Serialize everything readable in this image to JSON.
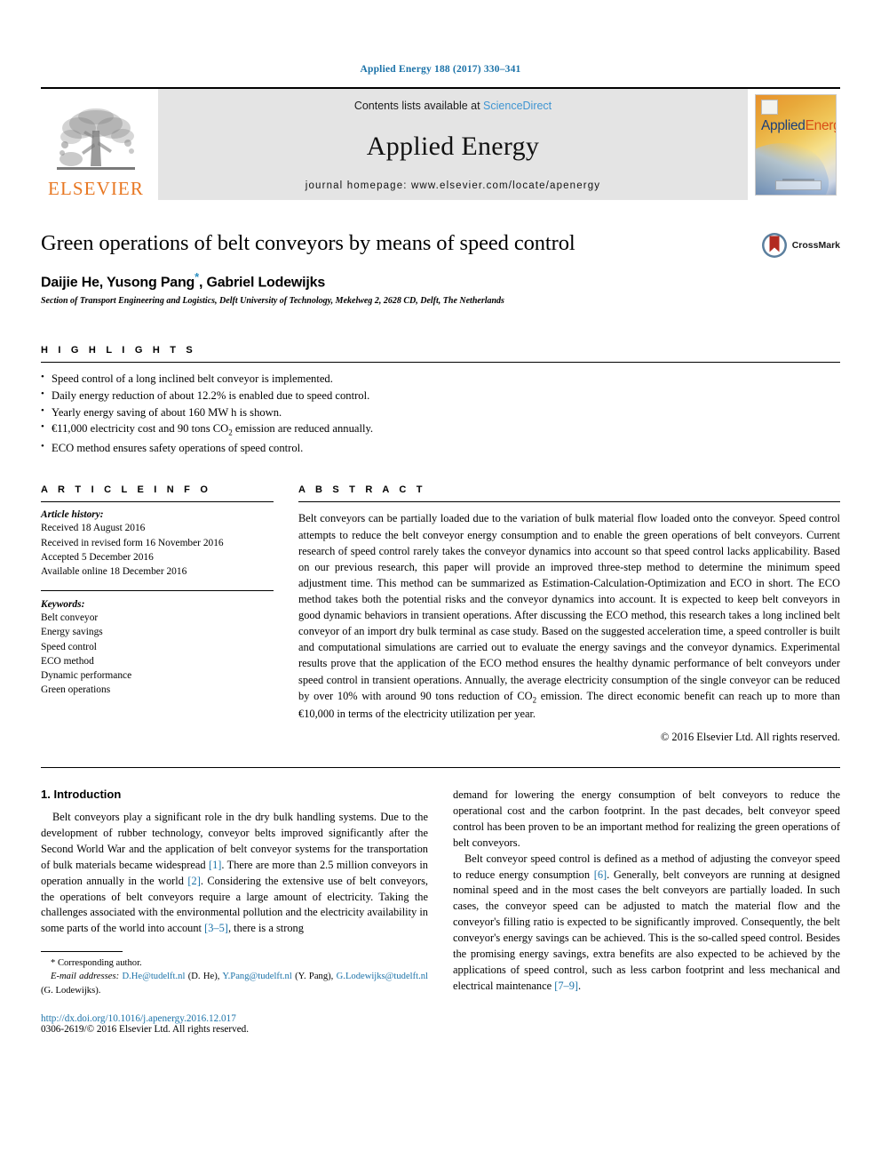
{
  "journal_ref": "Applied Energy 188 (2017) 330–341",
  "masthead": {
    "elsevier_wordmark": "ELSEVIER",
    "contents_prefix": "Contents lists available at ",
    "sciencedirect": "ScienceDirect",
    "journal_title": "Applied Energy",
    "homepage": "journal homepage: www.elsevier.com/locate/apenergy",
    "cover_title_part1": "Applied",
    "cover_title_part2": "Energy"
  },
  "title_block": {
    "title": "Green operations of belt conveyors by means of speed control",
    "authors_pre": "Daijie He, Yusong Pang",
    "authors_star": "*",
    "authors_post": ", Gabriel Lodewijks",
    "affiliation": "Section of Transport Engineering and Logistics, Delft University of Technology, Mekelweg 2, 2628 CD, Delft, The Netherlands",
    "crossmark_label": "CrossMark"
  },
  "highlights": {
    "heading": "H I G H L I G H T S",
    "items": [
      "Speed control of a long inclined belt conveyor is implemented.",
      "Daily energy reduction of about 12.2% is enabled due to speed control.",
      "Yearly energy saving of about 160 MW h is shown.",
      "€11,000 electricity cost and 90 tons CO2 emission are reduced annually.",
      "ECO method ensures safety operations of speed control."
    ]
  },
  "article_info": {
    "heading": "A R T I C L E   I N F O",
    "history_label": "Article history:",
    "history": [
      "Received 18 August 2016",
      "Received in revised form 16 November 2016",
      "Accepted 5 December 2016",
      "Available online 18 December 2016"
    ],
    "keywords_label": "Keywords:",
    "keywords": [
      "Belt conveyor",
      "Energy savings",
      "Speed control",
      "ECO method",
      "Dynamic performance",
      "Green operations"
    ]
  },
  "abstract": {
    "heading": "A B S T R A C T",
    "text": "Belt conveyors can be partially loaded due to the variation of bulk material flow loaded onto the conveyor. Speed control attempts to reduce the belt conveyor energy consumption and to enable the green operations of belt conveyors. Current research of speed control rarely takes the conveyor dynamics into account so that speed control lacks applicability. Based on our previous research, this paper will provide an improved three-step method to determine the minimum speed adjustment time. This method can be summarized as Estimation-Calculation-Optimization and ECO in short. The ECO method takes both the potential risks and the conveyor dynamics into account. It is expected to keep belt conveyors in good dynamic behaviors in transient operations. After discussing the ECO method, this research takes a long inclined belt conveyor of an import dry bulk terminal as case study. Based on the suggested acceleration time, a speed controller is built and computational simulations are carried out to evaluate the energy savings and the conveyor dynamics. Experimental results prove that the application of the ECO method ensures the healthy dynamic performance of belt conveyors under speed control in transient operations. Annually, the average electricity consumption of the single conveyor can be reduced by over 10% with around 90 tons reduction of CO2 emission. The direct economic benefit can reach up to more than €10,000 in terms of the electricity utilization per year.",
    "copyright": "© 2016 Elsevier Ltd. All rights reserved."
  },
  "body": {
    "section_title": "1. Introduction",
    "left_paragraph_1_a": "Belt conveyors play a significant role in the dry bulk handling systems. Due to the development of rubber technology, conveyor belts improved significantly after the Second World War and the application of belt conveyor systems for the transportation of bulk materials became widespread ",
    "left_cite_1": "[1]",
    "left_paragraph_1_b": ". There are more than 2.5 million conveyors in operation annually in the world ",
    "left_cite_2": "[2]",
    "left_paragraph_1_c": ". Considering the extensive use of belt conveyors, the operations of belt conveyors require a large amount of electricity. Taking the challenges associated with the environmental pollution and the electricity availability in some parts of the world into account ",
    "left_cite_3": "[3–5]",
    "left_paragraph_1_d": ", there is a strong",
    "right_paragraph_1": "demand for lowering the energy consumption of belt conveyors to reduce the operational cost and the carbon footprint. In the past decades, belt conveyor speed control has been proven to be an important method for realizing the green operations of belt conveyors.",
    "right_paragraph_2_a": "Belt conveyor speed control is defined as a method of adjusting the conveyor speed to reduce energy consumption ",
    "right_cite_6": "[6]",
    "right_paragraph_2_b": ". Generally, belt conveyors are running at designed nominal speed and in the most cases the belt conveyors are partially loaded. In such cases, the conveyor speed can be adjusted to match the material flow and the conveyor's filling ratio is expected to be significantly improved. Consequently, the belt conveyor's energy savings can be achieved. This is the so-called speed control. Besides the promising energy savings, extra benefits are also expected to be achieved by the applications of speed control, such as less carbon footprint and less mechanical and electrical maintenance ",
    "right_cite_79": "[7–9]",
    "right_paragraph_2_c": "."
  },
  "footnote": {
    "corresponding": "* Corresponding author.",
    "email_label": "E-mail addresses:",
    "email_1": "D.He@tudelft.nl",
    "email_1_name": " (D. He), ",
    "email_2": "Y.Pang@tudelft.nl",
    "email_2_name": " (Y. Pang), ",
    "email_3": "G.Lodewijks@tudelft.nl",
    "email_3_name": " (G. Lodewijks).",
    "doi": "http://dx.doi.org/10.1016/j.apenergy.2016.12.017",
    "issn": "0306-2619/© 2016 Elsevier Ltd. All rights reserved."
  },
  "colors": {
    "link_blue": "#1b72a8",
    "sciencedirect_blue": "#3f95d2",
    "elsevier_orange": "#e87722",
    "banner_grey": "#e4e4e4"
  }
}
